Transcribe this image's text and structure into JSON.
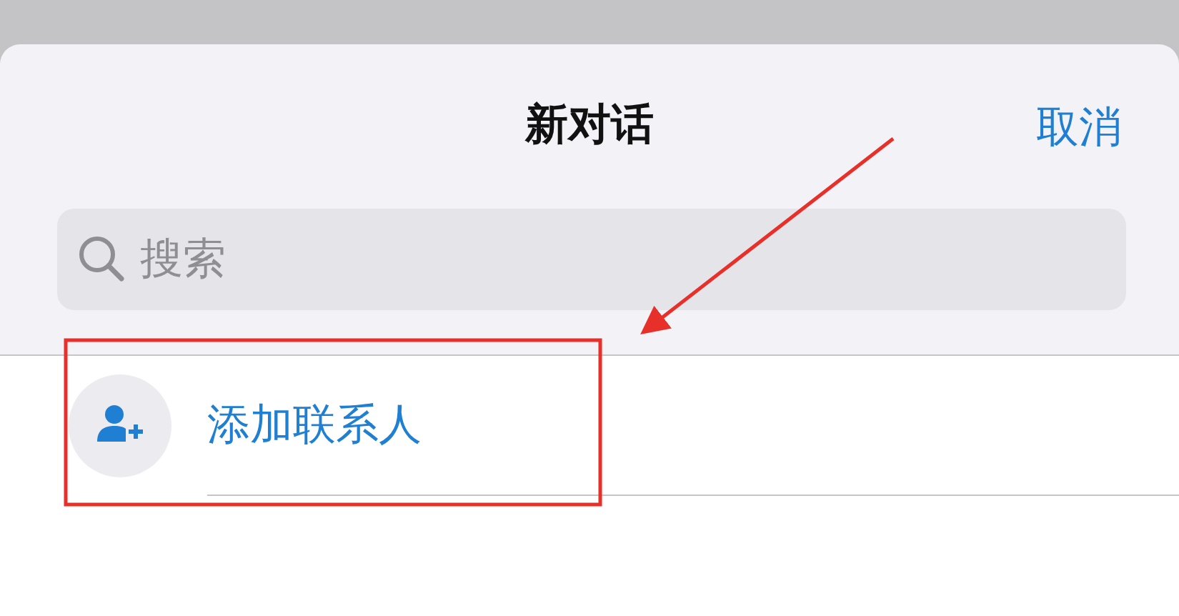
{
  "header": {
    "title": "新对话",
    "cancel": "取消"
  },
  "search": {
    "placeholder": "搜索"
  },
  "rows": [
    {
      "kind": "add-contact",
      "label": "添加联系人"
    }
  ]
}
